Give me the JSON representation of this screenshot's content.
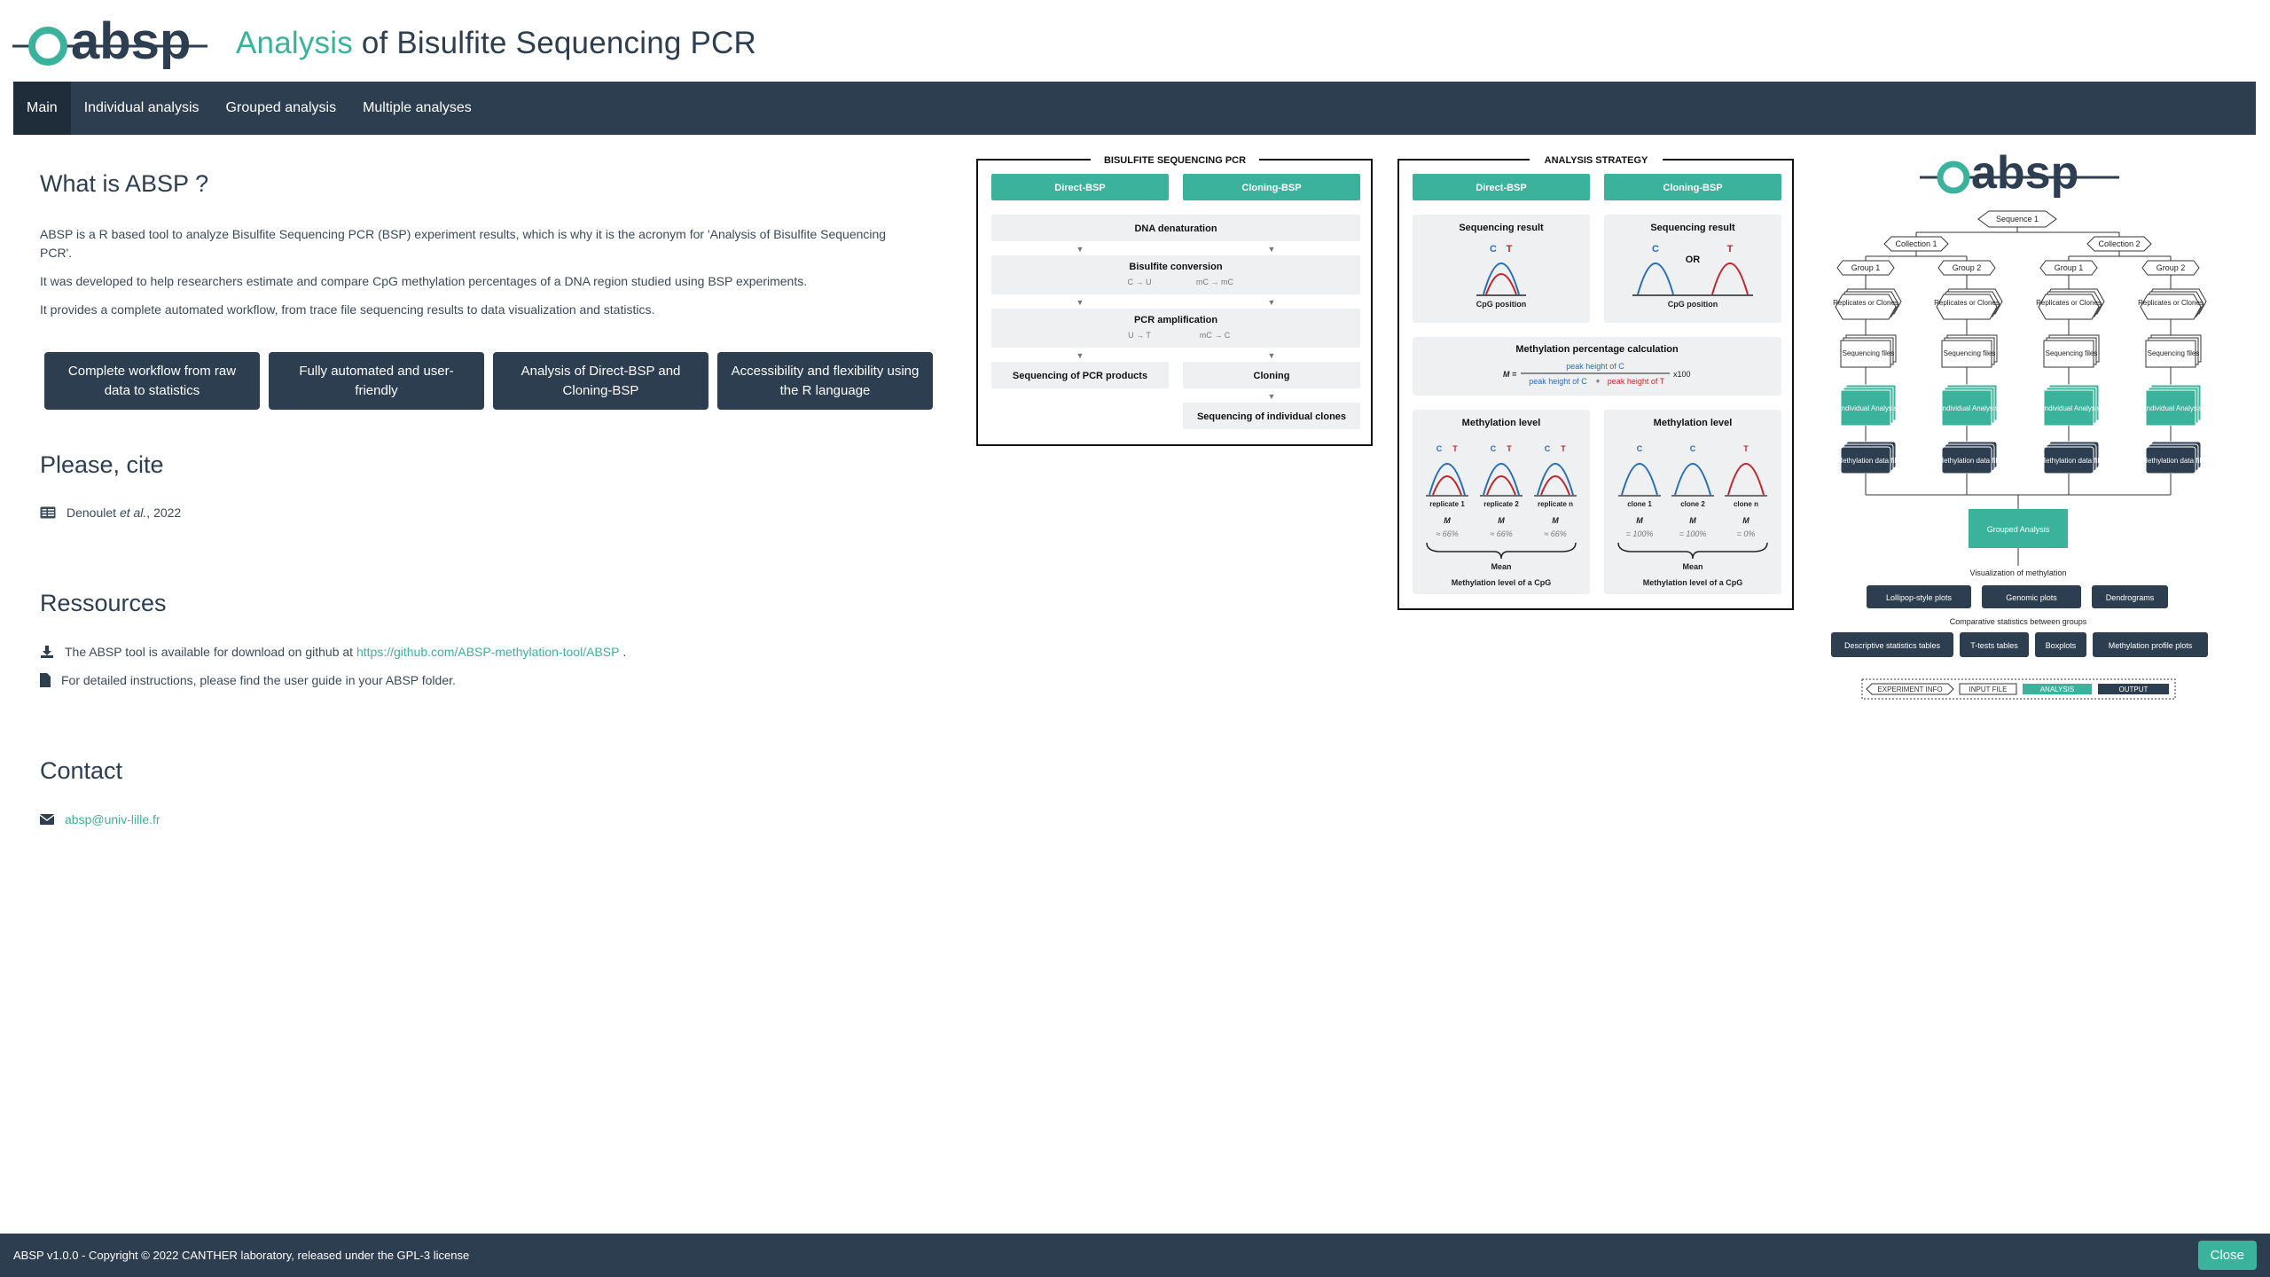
{
  "header": {
    "logo_text": "absp",
    "title_accent": "Analysis",
    "title_rest": " of Bisulfite Sequencing PCR"
  },
  "nav": {
    "items": [
      {
        "label": "Main",
        "active": true
      },
      {
        "label": "Individual analysis",
        "active": false
      },
      {
        "label": "Grouped analysis",
        "active": false
      },
      {
        "label": "Multiple analyses",
        "active": false
      }
    ]
  },
  "about": {
    "title": "What is ABSP ?",
    "p1": "ABSP is a R based tool to analyze Bisulfite Sequencing PCR (BSP) experiment results, which is why it is the acronym for 'Analysis of Bisulfite Sequencing PCR'.",
    "p2": "It was developed to help researchers estimate and compare CpG methylation percentages of a DNA region studied using BSP experiments.",
    "p3": "It provides a complete automated workflow, from trace file sequencing results to data visualization and statistics."
  },
  "features": [
    "Complete workflow from raw data to statistics",
    "Fully automated and user-friendly",
    "Analysis of Direct-BSP and Cloning-BSP",
    "Accessibility and flexibility using the R language"
  ],
  "cite": {
    "title": "Please, cite",
    "author": "Denoulet",
    "etal": "et al.",
    "year": ", 2022"
  },
  "resources": {
    "title": "Ressources",
    "line1_prefix": "The ABSP tool is available for download on github at ",
    "line1_link": "https://github.com/ABSP-methylation-tool/ABSP",
    "line1_suffix": " .",
    "line2": "For detailed instructions, please find the user guide in your ABSP folder."
  },
  "contact": {
    "title": "Contact",
    "email": "absp@univ-lille.fr"
  },
  "footer": {
    "text": "ABSP v1.0.0 - Copyright © 2022 CANTHER laboratory, released under the GPL-3 license",
    "close_label": "Close"
  },
  "icons": {
    "cite": "id-card-icon",
    "download": "download-icon",
    "file": "file-icon",
    "email": "envelope-icon"
  },
  "colors": {
    "accent": "#3bb29b",
    "navy": "#2c3e50"
  },
  "bsp_diagram": {
    "title": "BISULFITE SEQUENCING PCR",
    "direct": "Direct-BSP",
    "cloning": "Cloning-BSP",
    "denat": "DNA denaturation",
    "bisulfite": "Bisulfite conversion",
    "conv1": "C → U",
    "conv2": "mC → mC",
    "pcr": "PCR amplification",
    "amp1": "U → T",
    "amp2": "mC → C",
    "seq_pcr": "Sequencing of PCR products",
    "cloning_step": "Cloning",
    "seq_clones": "Sequencing of individual clones"
  },
  "strategy_diagram": {
    "title": "ANALYSIS STRATEGY",
    "direct": "Direct-BSP",
    "cloning": "Cloning-BSP",
    "seq_result": "Sequencing result",
    "cpg_position": "CpG position",
    "or": "OR",
    "c": "C",
    "t": "T",
    "calc_title": "Methylation percentage calculation",
    "m_eq": "M =",
    "numerator": "peak height of C",
    "denom_c": "peak height of C",
    "plus": " + ",
    "denom_t": "peak height of T",
    "x100": "x100",
    "level": "Methylation level",
    "rep1": "replicate 1",
    "rep2": "replicate 2",
    "repn": "replicate n",
    "clone1": "clone 1",
    "clone2": "clone 2",
    "clonen": "clone n",
    "m": "M",
    "v66": "≈ 66%",
    "v100": "= 100%",
    "v0": "= 0%",
    "mean": "Mean",
    "mean_desc": "Methylation level of a CpG"
  },
  "workflow_diagram": {
    "logo": "absp",
    "sequence": "Sequence 1",
    "collection1": "Collection 1",
    "collection2": "Collection 2",
    "group1": "Group 1",
    "group2": "Group 2",
    "replicates": "Replicates or Clones",
    "seqfiles": "Sequencing files",
    "indiv": "Individual Analysis",
    "methfile": "Methylation data file",
    "grouped": "Grouped Analysis",
    "vis": "Visualization of methylation",
    "plots": [
      "Lollipop-style plots",
      "Genomic plots",
      "Dendrograms"
    ],
    "comp": "Comparative statistics between groups",
    "stats": [
      "Descriptive statistics tables",
      "T-tests tables",
      "Boxplots",
      "Methylation profile plots"
    ],
    "legend": [
      "EXPERIMENT INFO",
      "INPUT FILE",
      "ANALYSIS",
      "OUTPUT"
    ]
  }
}
